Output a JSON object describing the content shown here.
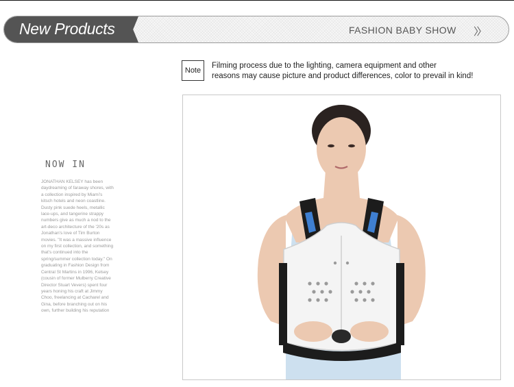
{
  "header": {
    "title": "New Products",
    "subtitle": "FASHION BABY SHOW",
    "chevron": "〉〉"
  },
  "note": {
    "label": "Note",
    "line1": "Filming process due to the lighting, camera equipment and other",
    "line2": "reasons may cause picture and product differences, color to prevail in kind!"
  },
  "editorial": {
    "heading": "NOW IN",
    "lines": [
      "JONATHAN KELSEY has been",
      "daydreaming of faraway shores, with",
      "a collection inspired by Miami's",
      "kitsch hotels and neon coastline.",
      "Dusty pink suede heels, metallic",
      "lace-ups, and tangerine strappy",
      "numbers give as much a nod to the",
      "art-deco architecture of the '20s as",
      "Jonathan's love of Tim Burton",
      "movies. \"It was a massive influence",
      "on my first collection, and something",
      "that's continued into the",
      "spring/summer collection today.\" On",
      "graduating in Fashion Design from",
      "Central St Martins in 1996, Kelsey",
      "(cousin of former Mulberry Creative",
      "Director Stuart Vevers) spent four",
      "years honing his craft at Jimmy",
      "Choo, freelancing at Cacharel and",
      "Gina, before branching out on his",
      "own, further building his reputation"
    ]
  },
  "product_photo": {
    "subject": "model-wearing-thoracic-spine-brace",
    "colors": {
      "brace": "#f4f4f4",
      "strap": "#1c1c1c",
      "pad": "#3f7fd1",
      "skin": "#ecc9b1",
      "tank": "#cde0ef",
      "hair": "#2a2220"
    }
  }
}
